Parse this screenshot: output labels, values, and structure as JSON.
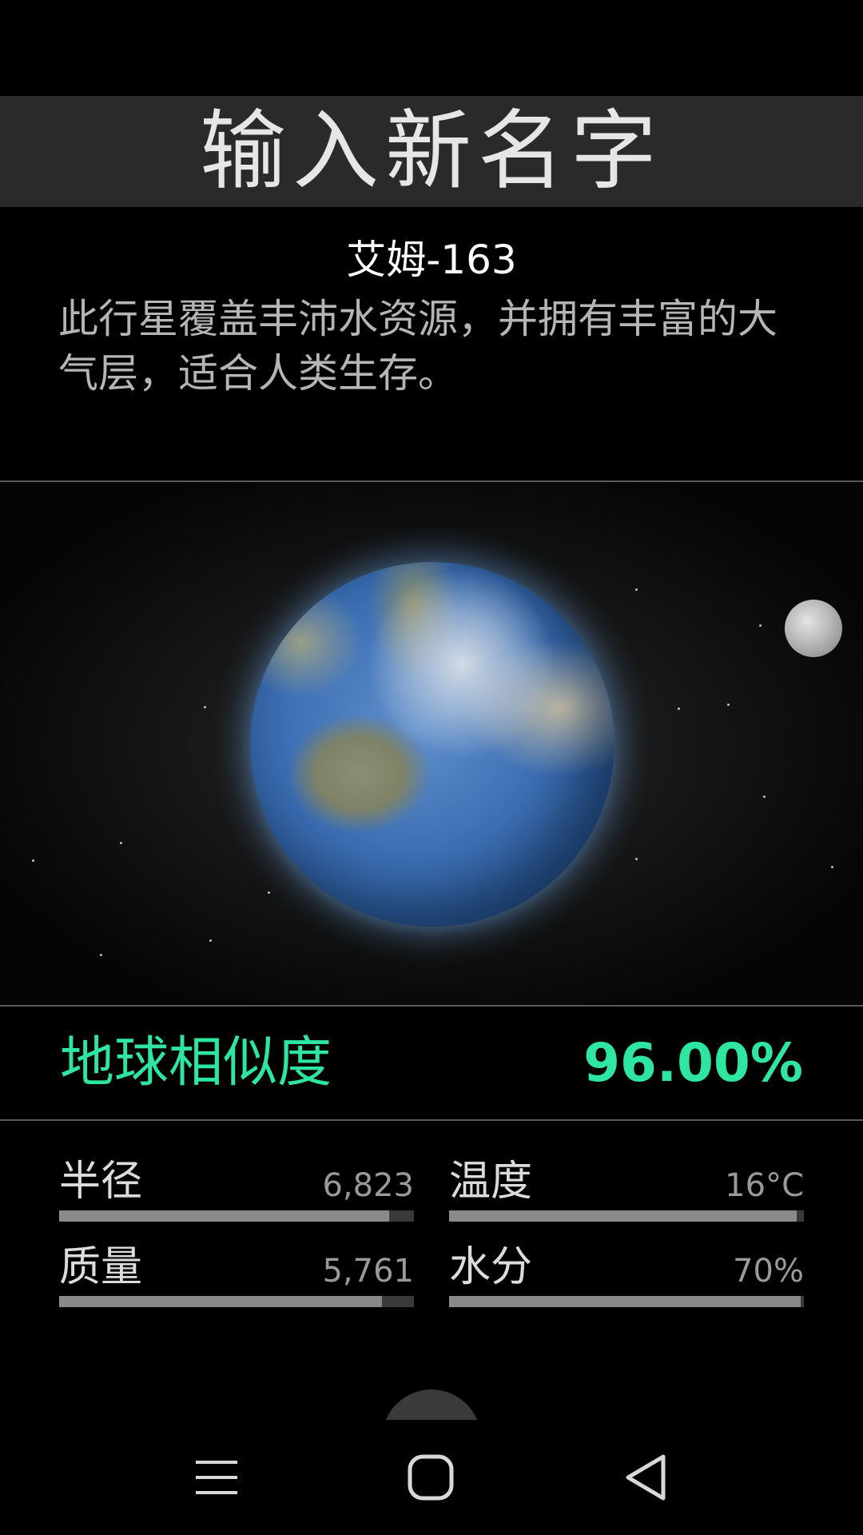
{
  "header": {
    "title": "输入新名字"
  },
  "planet": {
    "name": "艾姆-163",
    "description": "此行星覆盖丰沛水资源，并拥有丰富的大气层，适合人类生存。"
  },
  "similarity": {
    "label": "地球相似度",
    "value": "96.00%"
  },
  "stats": [
    {
      "label": "半径",
      "value": "6,823",
      "fill": 0.93
    },
    {
      "label": "温度",
      "value": "16°C",
      "fill": 0.98
    },
    {
      "label": "质量",
      "value": "5,761",
      "fill": 0.91
    },
    {
      "label": "水分",
      "value": "70%",
      "fill": 0.99
    }
  ],
  "nav": {
    "menu": "menu-icon",
    "home": "home-icon",
    "back": "back-icon"
  },
  "colors": {
    "accent": "#2fe6a0",
    "header_bg": "#2a2a2a",
    "bar_fill": "#8a8a8a"
  }
}
